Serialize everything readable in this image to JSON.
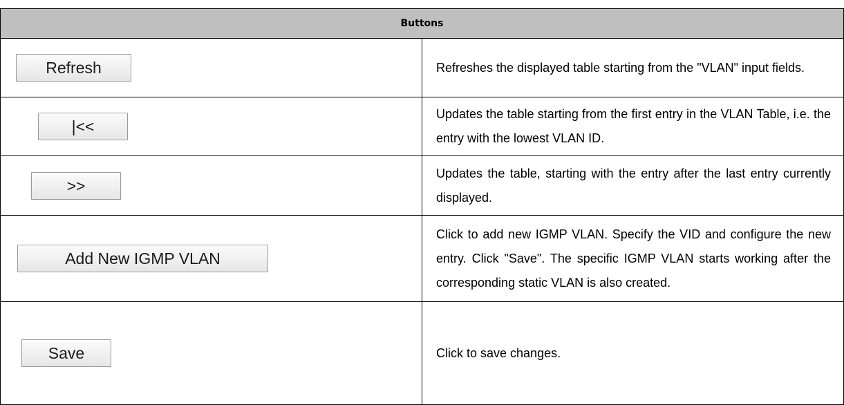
{
  "table": {
    "header": "Buttons",
    "rows": [
      {
        "button": "Refresh",
        "description": "Refreshes the displayed table starting from the \"VLAN\" input fields."
      },
      {
        "button": "|<<",
        "description": "Updates the table starting from the first entry in the VLAN Table, i.e. the entry with the lowest VLAN ID."
      },
      {
        "button": ">>",
        "description": "Updates the table, starting with the entry after the last entry currently displayed."
      },
      {
        "button": "Add New IGMP VLAN",
        "description": "Click to add new IGMP VLAN. Specify the VID and configure the new entry. Click \"Save\". The specific IGMP VLAN starts working after the corresponding static VLAN is also created."
      },
      {
        "button": "Save",
        "description": "Click to save changes."
      }
    ]
  }
}
